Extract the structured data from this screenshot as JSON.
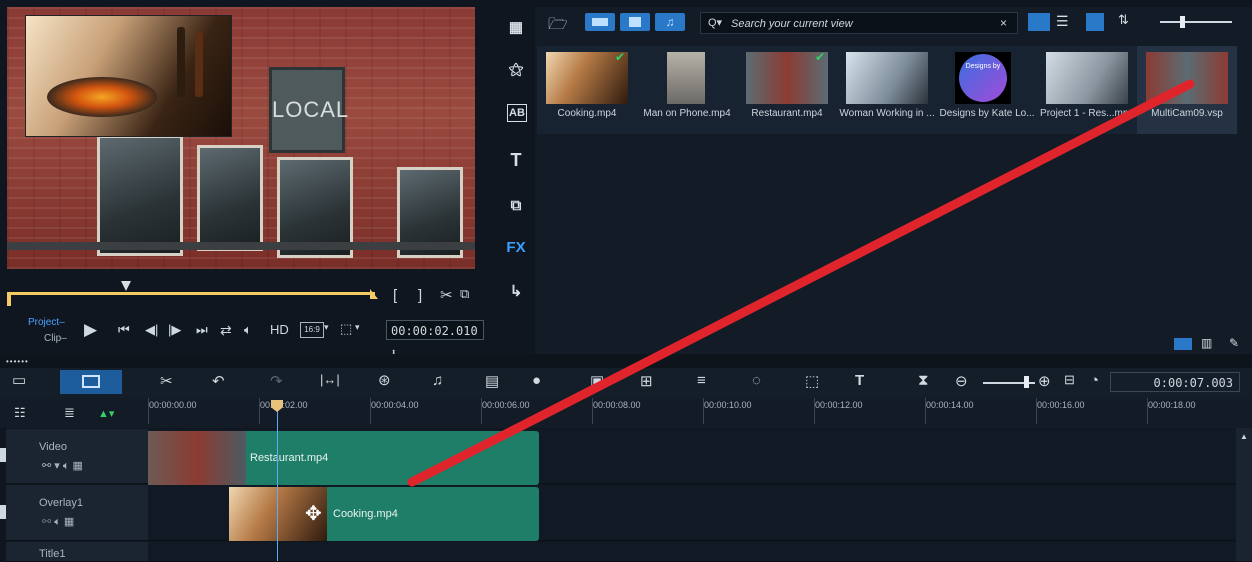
{
  "preview": {
    "sign_text": "LOCAL",
    "mode_project": "Project",
    "mode_clip": "Clip",
    "hd_label": "HD",
    "aspect_label": "16:9",
    "timecode": "00:00:02.010"
  },
  "library": {
    "search_placeholder": "Search your current view",
    "items": [
      {
        "label": "Cooking.mp4"
      },
      {
        "label": "Man on Phone.mp4"
      },
      {
        "label": "Restaurant.mp4"
      },
      {
        "label": "Woman Working in ..."
      },
      {
        "label": "Designs by Kate Lo..."
      },
      {
        "label": "Project 1 - Res...mp4"
      },
      {
        "label": "MultiCam09.vsp"
      }
    ],
    "thumb_logo_text": "Designs by"
  },
  "sidebar": {
    "fx_label": "FX"
  },
  "timeline": {
    "timecode": "0:00:07.003",
    "ruler": [
      "00:00:00.00",
      "00:00:02.00",
      "00:00:04.00",
      "00:00:06.00",
      "00:00:08.00",
      "00:00:10.00",
      "00:00:12.00",
      "00:00:14.00",
      "00:00:16.00",
      "00:00:18.00"
    ],
    "tracks": [
      {
        "name": "Video",
        "clip": "Restaurant.mp4"
      },
      {
        "name": "Overlay1",
        "clip": "Cooking.mp4"
      },
      {
        "name": "Title1"
      }
    ]
  },
  "colors": {
    "accent": "#2a78c8",
    "clip": "#1e7e68",
    "annotation": "#e0242c",
    "scrub": "#f3cb62"
  }
}
